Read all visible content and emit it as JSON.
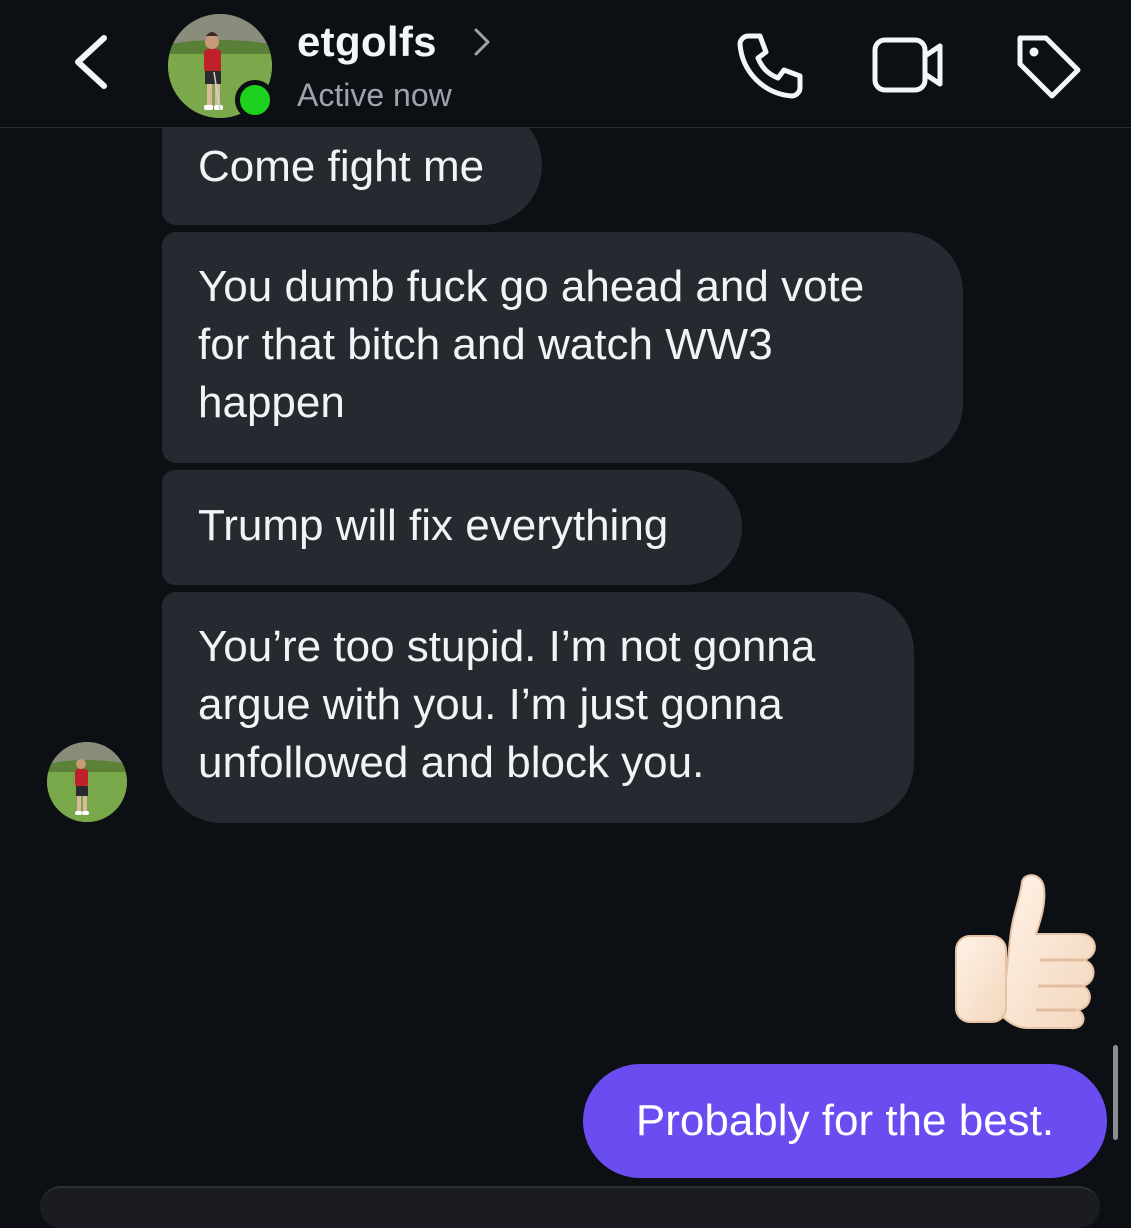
{
  "header": {
    "contact_name": "etgolfs",
    "status": "Active now",
    "icons": {
      "back": "chevron-left-icon",
      "name_chevron": "chevron-right-icon",
      "call": "phone-icon",
      "video": "video-camera-icon",
      "tag": "tag-icon"
    },
    "online_color": "#1fd11f"
  },
  "messages": [
    {
      "from": "contact",
      "lines": [
        "Come fight me"
      ]
    },
    {
      "from": "contact",
      "lines": [
        "You dumb fuck go ahead and vote",
        "for that bitch and watch WW3",
        "happen"
      ]
    },
    {
      "from": "contact",
      "lines": [
        "Trump will fix everything"
      ]
    },
    {
      "from": "contact",
      "lines": [
        "You’re too stupid. I’m not gonna",
        "argue with you. I’m just gonna",
        "unfollowed and block you."
      ]
    },
    {
      "from": "me",
      "emoji": "thumbs-up-icon"
    },
    {
      "from": "me",
      "lines": [
        "Probably for the best."
      ]
    }
  ],
  "colors": {
    "background": "#0c0f14",
    "received_bubble": "#26292f",
    "sent_bubble": "#6a4cf0",
    "secondary_text": "#9ea2ab"
  }
}
